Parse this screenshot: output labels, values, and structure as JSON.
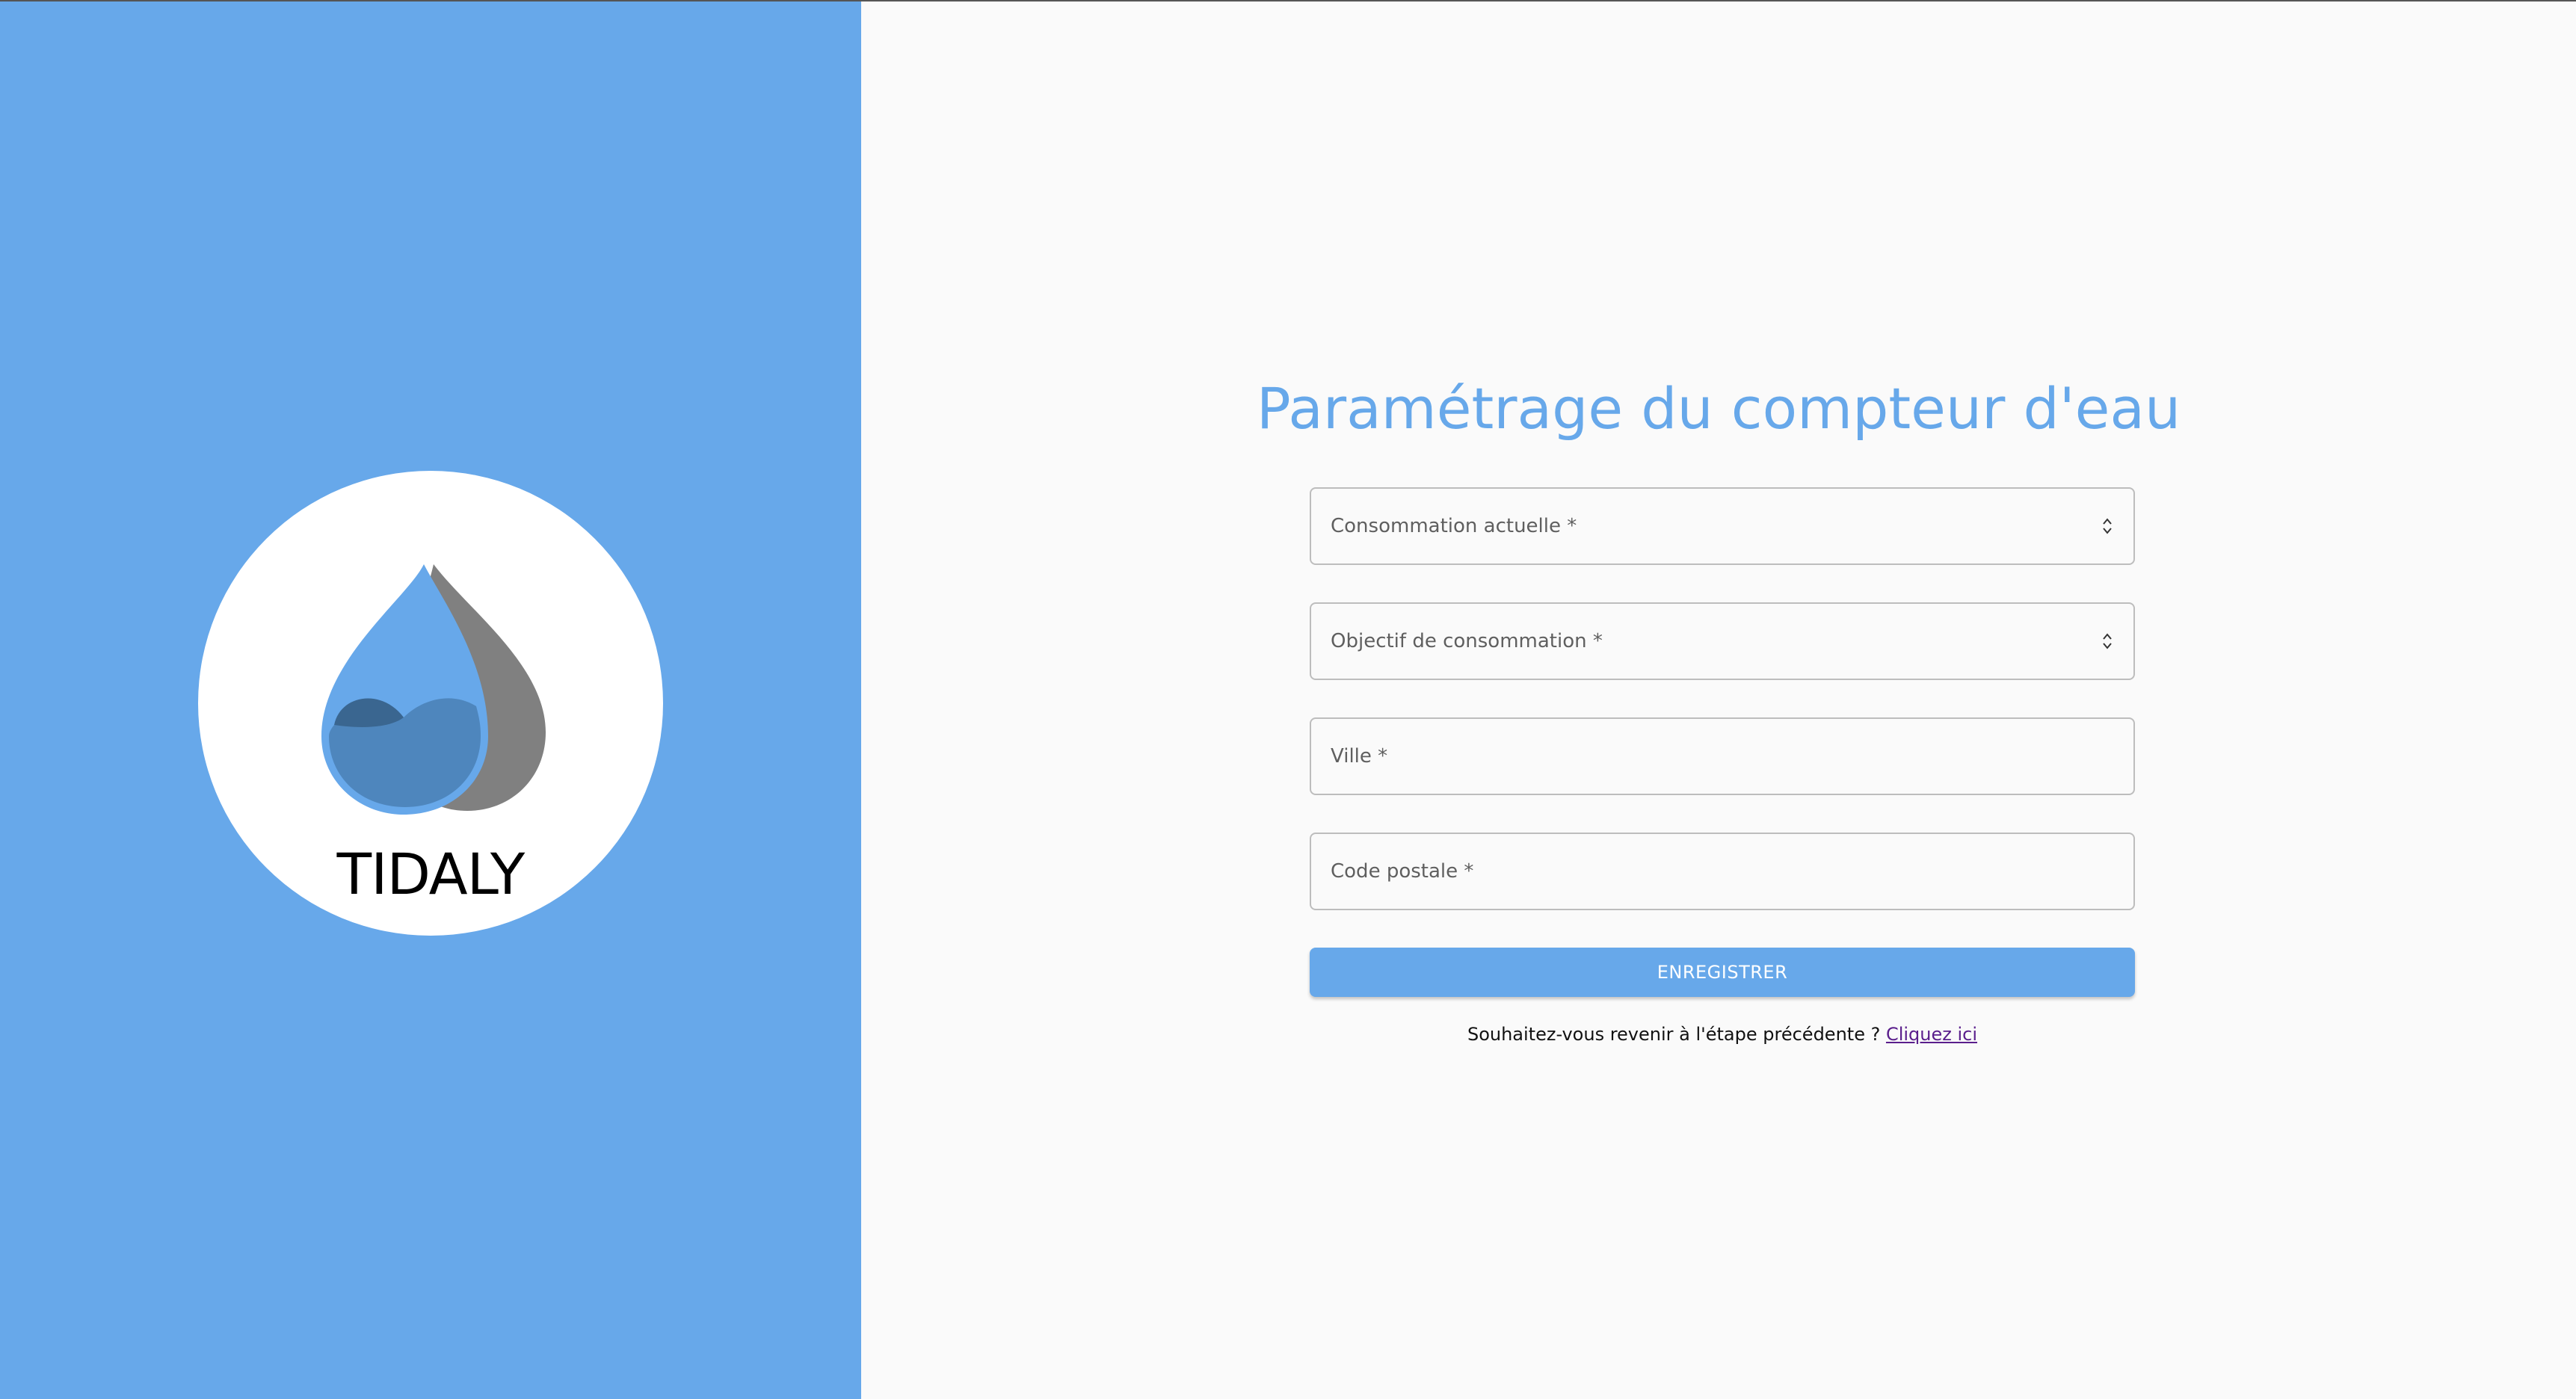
{
  "brand": {
    "name": "TIDALY",
    "colors": {
      "primary": "#67a8ea",
      "drop_fill": "#4e86bd",
      "drop_wave": "#3a6690",
      "drop_shadow": "#808080"
    }
  },
  "form": {
    "title": "Paramétrage du compteur d'eau",
    "fields": [
      {
        "label": "Consommation actuelle *",
        "type": "number"
      },
      {
        "label": "Objectif de consommation *",
        "type": "number"
      },
      {
        "label": "Ville *",
        "type": "text"
      },
      {
        "label": "Code postale *",
        "type": "text"
      }
    ],
    "submit_label": "ENREGISTRER",
    "back_prompt": "Souhaitez-vous revenir à l'étape précédente ? ",
    "back_link": "Cliquez ici"
  }
}
